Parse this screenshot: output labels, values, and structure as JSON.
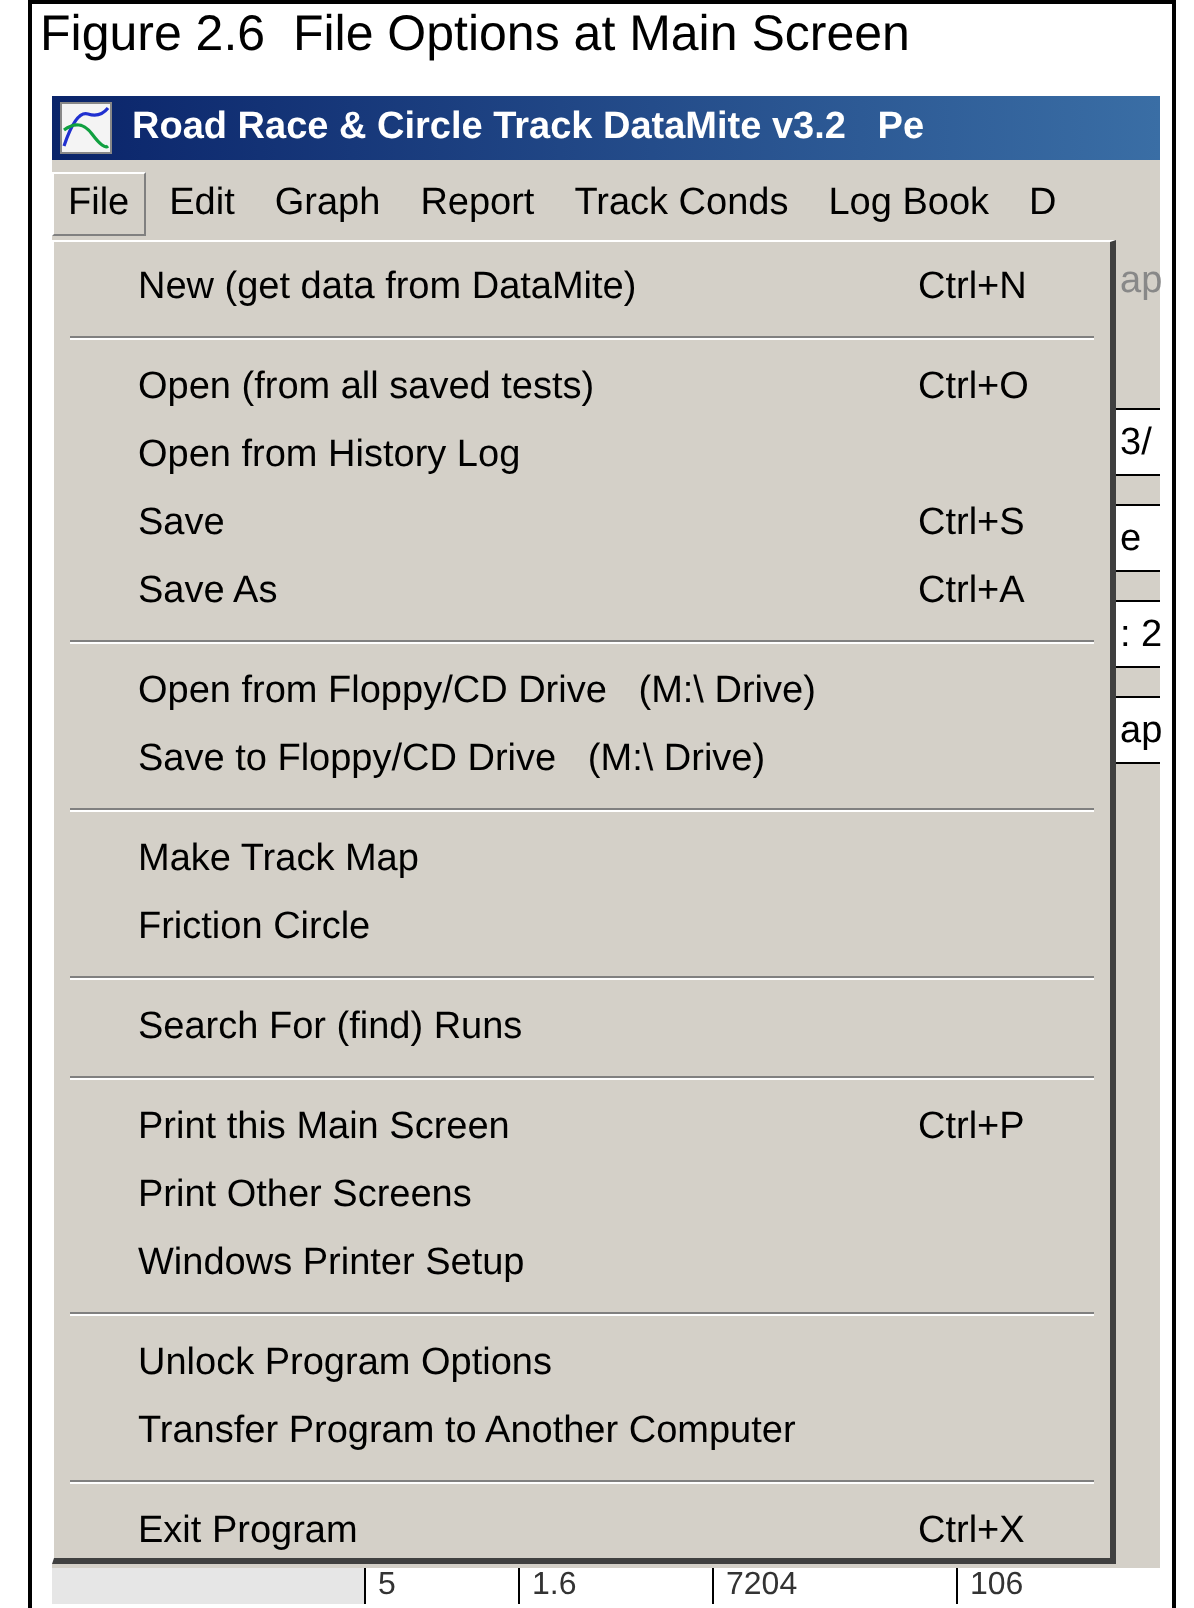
{
  "caption": "Figure 2.6  File Options at Main Screen",
  "window": {
    "title": "Road Race & Circle Track DataMite v3.2   Pe"
  },
  "menu_bar": [
    {
      "label": "File",
      "selected": true
    },
    {
      "label": "Edit",
      "selected": false
    },
    {
      "label": "Graph",
      "selected": false
    },
    {
      "label": "Report",
      "selected": false
    },
    {
      "label": "Track Conds",
      "selected": false
    },
    {
      "label": "Log Book",
      "selected": false
    },
    {
      "label": "D",
      "selected": false
    }
  ],
  "file_menu": [
    [
      {
        "label": "New (get data from DataMite)",
        "shortcut": "Ctrl+N"
      }
    ],
    [
      {
        "label": "Open (from all saved tests)",
        "shortcut": "Ctrl+O"
      },
      {
        "label": "Open from History Log"
      },
      {
        "label": "Save",
        "shortcut": "Ctrl+S"
      },
      {
        "label": "Save As",
        "shortcut": "Ctrl+A"
      }
    ],
    [
      {
        "label": "Open from Floppy/CD Drive   (M:\\ Drive)"
      },
      {
        "label": "Save to Floppy/CD Drive   (M:\\ Drive)"
      }
    ],
    [
      {
        "label": "Make Track Map"
      },
      {
        "label": "Friction Circle"
      }
    ],
    [
      {
        "label": "Search For (find) Runs"
      }
    ],
    [
      {
        "label": "Print this Main Screen",
        "shortcut": "Ctrl+P"
      },
      {
        "label": "Print Other Screens"
      },
      {
        "label": "Windows Printer Setup"
      }
    ],
    [
      {
        "label": "Unlock Program Options"
      },
      {
        "label": "Transfer Program to Another Computer"
      }
    ],
    [
      {
        "label": "Exit Program",
        "shortcut": "Ctrl+X"
      }
    ]
  ],
  "background": {
    "fragments": [
      {
        "kind": "label",
        "text": "ap"
      },
      {
        "kind": "field",
        "text": "3/"
      },
      {
        "kind": "field",
        "text": "e"
      },
      {
        "kind": "field",
        "text": ": 2"
      },
      {
        "kind": "field",
        "text": "ap"
      }
    ],
    "table_row": [
      "5",
      "1.6",
      "7204",
      "106"
    ]
  }
}
